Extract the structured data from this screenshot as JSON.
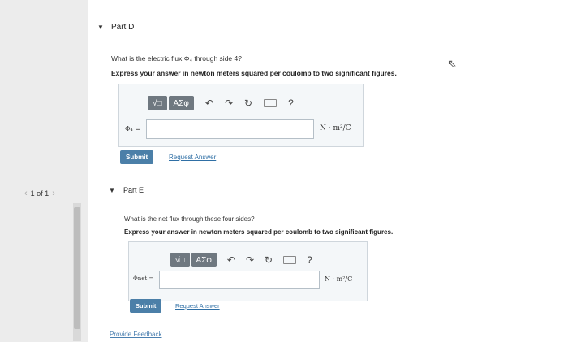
{
  "pager": {
    "label": "1 of 1",
    "prev": "‹",
    "next": "›"
  },
  "partD": {
    "title": "Part D",
    "question": "What is the electric flux Φ₄ through side 4?",
    "instruction": "Express your answer in newton meters squared per coulomb to two significant figures.",
    "toolbar": {
      "sqrt_label": "√□",
      "greek_label": "ΑΣφ",
      "help_label": "?"
    },
    "variable": "Φ₄ =",
    "unit": "N · m²/C",
    "submit_label": "Submit",
    "request_label": "Request Answer"
  },
  "partE": {
    "title": "Part E",
    "question": "What is the net flux through these four sides?",
    "instruction": "Express your answer in newton meters squared per coulomb to two significant figures.",
    "toolbar": {
      "sqrt_label": "√□",
      "greek_label": "ΑΣφ",
      "help_label": "?"
    },
    "variable": "Φnet =",
    "unit": "N · m²/C",
    "submit_label": "Submit",
    "request_label": "Request Answer"
  },
  "feedback_label": "Provide Feedback"
}
